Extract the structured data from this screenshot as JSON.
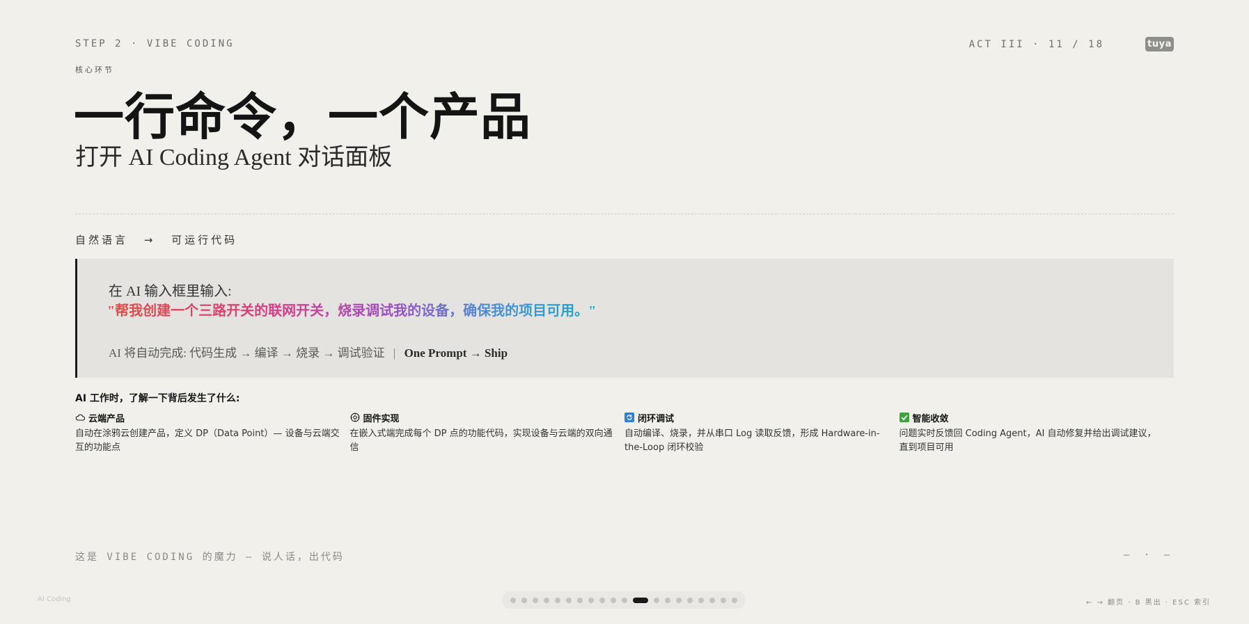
{
  "header": {
    "step_label": "STEP 2 · VIBE CODING",
    "core_label": "核心环节",
    "act_counter": "ACT III · 11 / 18",
    "logo_text": "tuya"
  },
  "hero": {
    "title": "一行命令，一个产品",
    "subtitle": "打开 AI Coding Agent 对话面板"
  },
  "flow": {
    "from": "自然语言",
    "arrow": "→",
    "to": "可运行代码"
  },
  "prompt": {
    "intro": "在 AI 输入框里输入:",
    "text": "\"帮我创建一个三路开关的联网开关，烧录调试我的设备，确保我的项目可用。\"",
    "pipeline_prefix": "AI 将自动完成: 代码生成 → 编译 → 烧录 → 调试验证",
    "pipeline_sep": "|",
    "pipeline_strong": "One Prompt → Ship",
    "gradient_colors": [
      "#e34b3f",
      "#d93c86",
      "#9b4dc4",
      "#4a8ed8",
      "#19a8c9"
    ]
  },
  "behind": {
    "heading": "AI 工作时，了解一下背后发生了什么:",
    "cards": [
      {
        "icon": "cloud-icon",
        "title": "云端产品",
        "desc": "自动在涂鸦云创建产品，定义 DP（Data Point）— 设备与云端交互的功能点"
      },
      {
        "icon": "chip-icon",
        "title": "固件实现",
        "desc": "在嵌入式端完成每个 DP 点的功能代码，实现设备与云端的双向通信"
      },
      {
        "icon": "loop-icon",
        "title": "闭环调试",
        "desc": "自动编译、烧录，并从串口 Log 读取反馈，形成 Hardware-in-the-Loop 闭环校验"
      },
      {
        "icon": "check-icon",
        "title": "智能收敛",
        "desc": "问题实时反馈回 Coding Agent，AI 自动修复并给出调试建议，直到项目可用"
      }
    ]
  },
  "footer": {
    "tagline": "这是 VIBE CODING 的魔力 — 说人话，出代码",
    "dashes": "— · —",
    "corner_text": "AI Coding",
    "nav_hints": "← → 翻页 · B 黑出 · ESC 索引",
    "current_page": 11,
    "total_pages": 20
  },
  "colors": {
    "background": "#f1f0eb",
    "prompt_box": "#e4e3df",
    "accent_dark": "#1a1a1a"
  }
}
